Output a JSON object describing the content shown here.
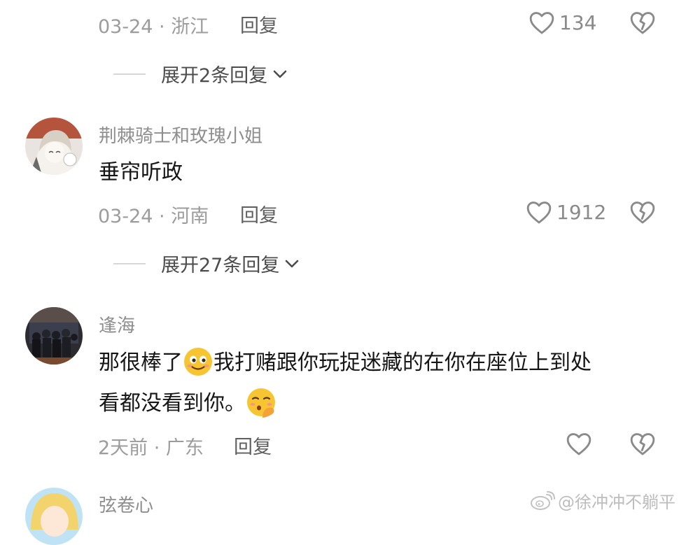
{
  "comments": [
    {
      "meta": "03-24 · 浙江",
      "reply_label": "回复",
      "likes": "134",
      "expand": {
        "label": "展开2条回复"
      }
    },
    {
      "username": "荆棘骑士和玫瑰小姐",
      "text": "垂帘听政",
      "meta": "03-24 · 河南",
      "reply_label": "回复",
      "likes": "1912",
      "expand": {
        "label": "展开27条回复"
      }
    },
    {
      "username": "逢海",
      "text_line1_a": "那很棒了",
      "text_line1_b": "我打赌跟你玩捉迷藏的在你在座位上到处",
      "text_line2": "看都没看到你。",
      "meta": "2天前 · 广东",
      "reply_label": "回复",
      "likes": ""
    },
    {
      "username": "弦卷心"
    }
  ],
  "watermark": {
    "text": "@徐冲冲不躺平"
  },
  "colors": {
    "meta_gray": "#9c9c9c",
    "text_dark": "#161616",
    "icon_gray": "#8a8a8a",
    "emoji_yellow": "#f7c531"
  },
  "icons": [
    "heart-outline-icon",
    "broken-heart-icon",
    "chevron-down-icon",
    "weibo-logo-icon",
    "smile-emoji",
    "shush-emoji"
  ]
}
